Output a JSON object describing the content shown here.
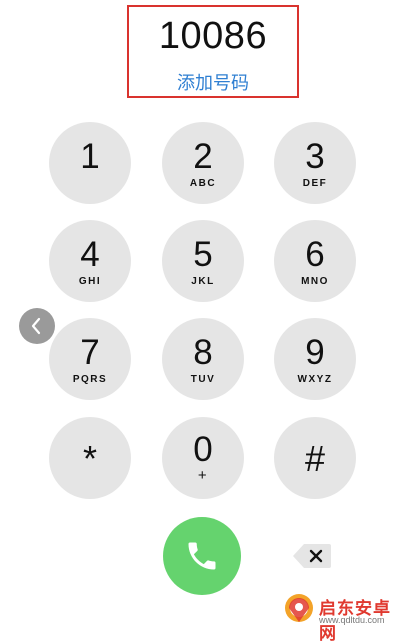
{
  "dialer": {
    "number": "10086",
    "add_number_label": "添加号码"
  },
  "keys": [
    {
      "digit": "1",
      "letters": ""
    },
    {
      "digit": "2",
      "letters": "ABC"
    },
    {
      "digit": "3",
      "letters": "DEF"
    },
    {
      "digit": "4",
      "letters": "GHI"
    },
    {
      "digit": "5",
      "letters": "JKL"
    },
    {
      "digit": "6",
      "letters": "MNO"
    },
    {
      "digit": "7",
      "letters": "PQRS"
    },
    {
      "digit": "8",
      "letters": "TUV"
    },
    {
      "digit": "9",
      "letters": "WXYZ"
    },
    {
      "digit": "*",
      "letters": ""
    },
    {
      "digit": "0",
      "letters": "+"
    },
    {
      "digit": "#",
      "letters": ""
    }
  ],
  "icons": {
    "back": "chevron-left-icon",
    "call": "phone-icon",
    "delete": "backspace-icon",
    "watermark_logo": "watermark-logo-icon"
  },
  "colors": {
    "key_background": "#e5e5e5",
    "call_green": "#65d36e",
    "link_blue": "#2f7fd2",
    "highlight_red": "#d9332e"
  },
  "watermark": {
    "title": "启东安卓网",
    "url": "www.qdltdu.com"
  }
}
